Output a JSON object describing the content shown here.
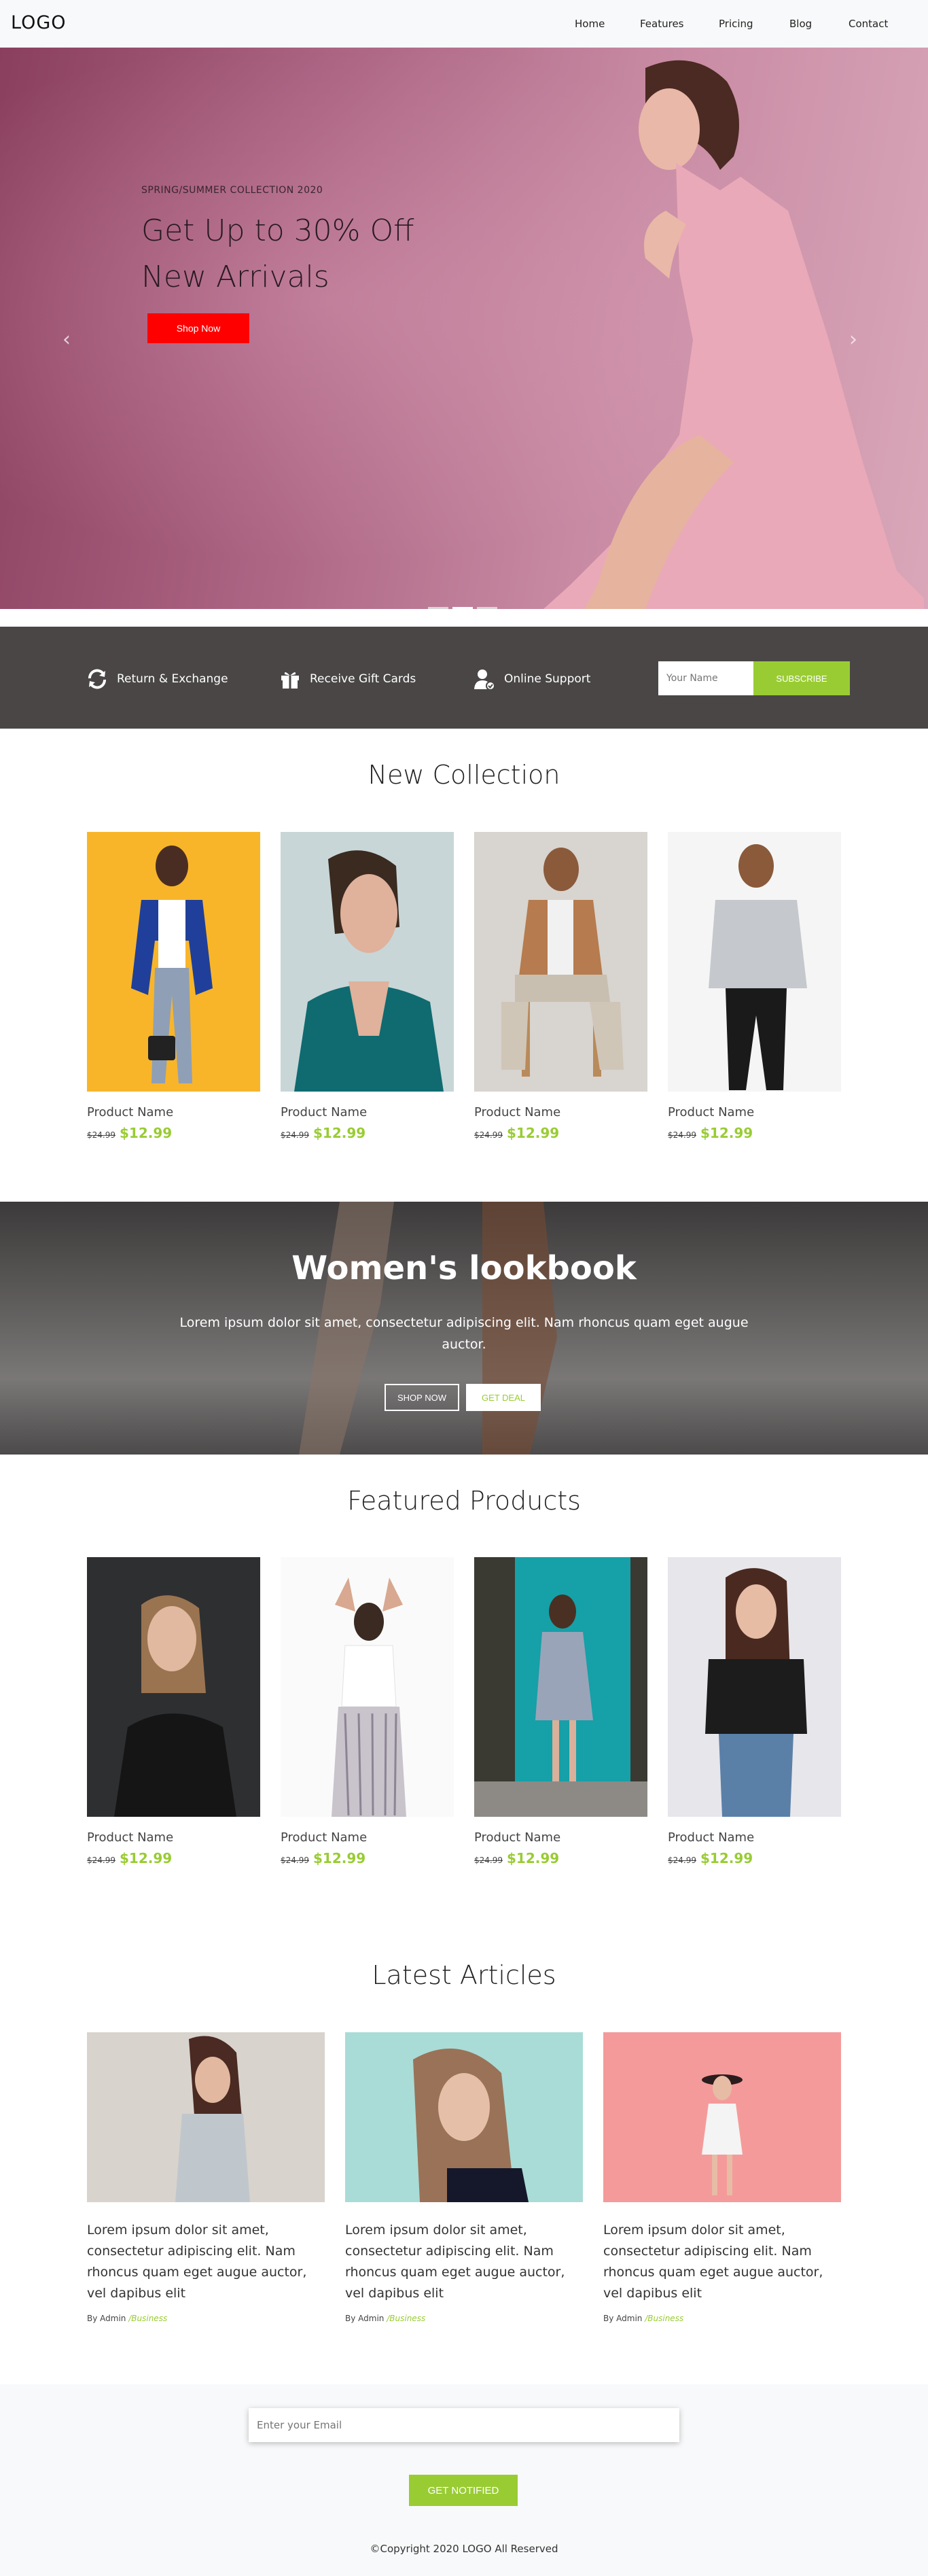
{
  "header": {
    "logo": "LOGO",
    "nav": [
      "Home",
      "Features",
      "Pricing",
      "Blog",
      "Contact"
    ]
  },
  "hero": {
    "subtitle": "SPRING/SUMMER COLLECTION 2020",
    "title_line1": "Get Up to 30% Off",
    "title_line2": "New Arrivals",
    "button": "Shop Now",
    "prev_icon": "chevron-left-icon",
    "next_icon": "chevron-right-icon",
    "slides": 3,
    "active_slide": 2
  },
  "features": {
    "items": [
      {
        "icon": "refresh-icon",
        "label": "Return & Exchange"
      },
      {
        "icon": "gift-icon",
        "label": "Receive Gift Cards"
      },
      {
        "icon": "user-support-icon",
        "label": "Online Support"
      }
    ],
    "subscribe_placeholder": "Your Name",
    "subscribe_button": "SUBSCRIBE"
  },
  "new_collection": {
    "title": "New Collection",
    "products": [
      {
        "name": "Product Name",
        "old_price": "$24.99",
        "price": "$12.99"
      },
      {
        "name": "Product Name",
        "old_price": "$24.99",
        "price": "$12.99"
      },
      {
        "name": "Product Name",
        "old_price": "$24.99",
        "price": "$12.99"
      },
      {
        "name": "Product Name",
        "old_price": "$24.99",
        "price": "$12.99"
      }
    ]
  },
  "lookbook": {
    "title": "Women's lookbook",
    "text": "Lorem ipsum dolor sit amet, consectetur adipiscing elit. Nam rhoncus quam eget augue auctor.",
    "button_shop": "SHOP NOW",
    "button_deal": "GET DEAL"
  },
  "featured": {
    "title": "Featured Products",
    "products": [
      {
        "name": "Product Name",
        "old_price": "$24.99",
        "price": "$12.99"
      },
      {
        "name": "Product Name",
        "old_price": "$24.99",
        "price": "$12.99"
      },
      {
        "name": "Product Name",
        "old_price": "$24.99",
        "price": "$12.99"
      },
      {
        "name": "Product Name",
        "old_price": "$24.99",
        "price": "$12.99"
      }
    ]
  },
  "articles": {
    "title": "Latest Articles",
    "items": [
      {
        "text": "Lorem ipsum dolor sit amet, consectetur adipiscing elit. Nam rhoncus quam eget augue auctor, vel dapibus elit",
        "author": "By Admin",
        "category": "/Business"
      },
      {
        "text": "Lorem ipsum dolor sit amet, consectetur adipiscing elit. Nam rhoncus quam eget augue auctor, vel dapibus elit",
        "author": "By Admin",
        "category": "/Business"
      },
      {
        "text": "Lorem ipsum dolor sit amet, consectetur adipiscing elit. Nam rhoncus quam eget augue auctor, vel dapibus elit",
        "author": "By Admin",
        "category": "/Business"
      }
    ]
  },
  "footer": {
    "email_placeholder": "Enter your Email",
    "notify_button": "GET NOTIFIED",
    "copyright": "©Copyright 2020 LOGO All Reserved"
  },
  "colors": {
    "accent": "#99cc33",
    "hero_button": "#ff0000",
    "feature_strip": "#4a4646"
  }
}
